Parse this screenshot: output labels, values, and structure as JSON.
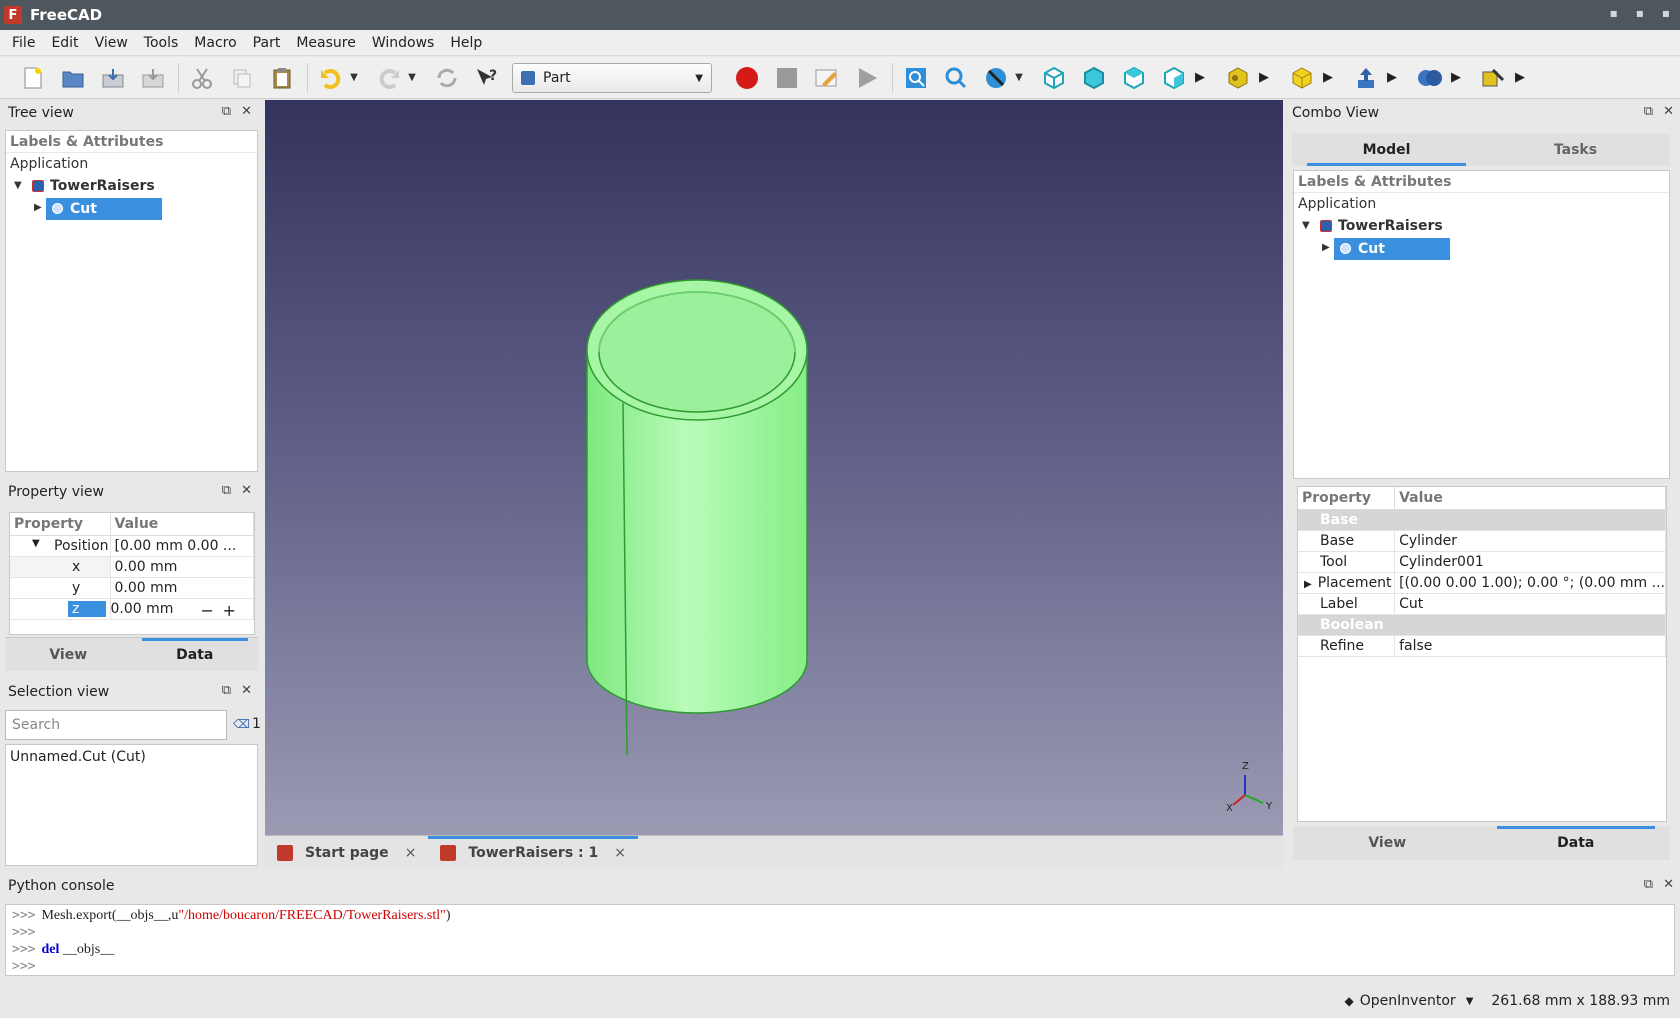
{
  "window": {
    "title": "FreeCAD",
    "logo_letter": "F"
  },
  "menu": [
    "File",
    "Edit",
    "View",
    "Tools",
    "Macro",
    "Part",
    "Measure",
    "Windows",
    "Help"
  ],
  "toolbar": {
    "workbench": "Part"
  },
  "tree_view": {
    "title": "Tree view",
    "header": "Labels & Attributes",
    "application": "Application",
    "document": "TowerRaisers",
    "selected_item": "Cut"
  },
  "property_view": {
    "title": "Property view",
    "col_property": "Property",
    "col_value": "Value",
    "rows": [
      {
        "name": "Position",
        "value": "[0.00 mm  0.00 ..."
      },
      {
        "name": "x",
        "value": "0.00 mm"
      },
      {
        "name": "y",
        "value": "0.00 mm"
      },
      {
        "name": "z",
        "value": "0.00 mm"
      }
    ],
    "tabs": [
      "View",
      "Data"
    ]
  },
  "selection_view": {
    "title": "Selection view",
    "search_placeholder": "Search",
    "count": "1",
    "items": [
      "Unnamed.Cut (Cut)"
    ]
  },
  "document_tabs": [
    {
      "label": "Start page"
    },
    {
      "label": "TowerRaisers : 1"
    }
  ],
  "combo_view": {
    "title": "Combo View",
    "tabs": [
      "Model",
      "Tasks"
    ],
    "tree_header": "Labels & Attributes",
    "application": "Application",
    "document": "TowerRaisers",
    "selected_item": "Cut",
    "col_property": "Property",
    "col_value": "Value",
    "groups": [
      {
        "name": "Base",
        "rows": [
          {
            "name": "Base",
            "value": "Cylinder"
          },
          {
            "name": "Tool",
            "value": "Cylinder001"
          },
          {
            "name": "Placement",
            "value": "[(0.00 0.00 1.00); 0.00 °; (0.00 mm ..."
          },
          {
            "name": "Label",
            "value": "Cut"
          }
        ]
      },
      {
        "name": "Boolean",
        "rows": [
          {
            "name": "Refine",
            "value": "false"
          }
        ]
      }
    ],
    "bottom_tabs": [
      "View",
      "Data"
    ]
  },
  "axis": {
    "z": "Z",
    "y": "Y",
    "x": "X"
  },
  "python_console": {
    "title": "Python console",
    "prompt": ">>>",
    "line1_code": "Mesh.export(__objs__,u",
    "line1_string": "\"/home/boucaron/FREECAD/TowerRaisers.stl\"",
    "line1_close": ")",
    "line3_kw": "del",
    "line3_rest": "__objs__"
  },
  "statusbar": {
    "renderer": "OpenInventor",
    "dimensions": "261.68 mm x 188.93 mm"
  },
  "colors": {
    "accent": "#3a8fde",
    "model_green": "#9cf59c",
    "titlebar": "#4f575e"
  }
}
